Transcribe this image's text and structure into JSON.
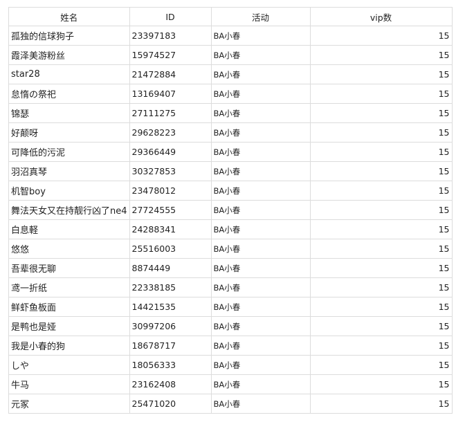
{
  "table": {
    "headers": [
      "姓名",
      "ID",
      "活动",
      "vip数"
    ],
    "rows": [
      {
        "name": "孤独的信球狗子",
        "id": "23397183",
        "activity": "BA小春",
        "vip": "15"
      },
      {
        "name": "霞泽美游粉丝",
        "id": "15974527",
        "activity": "BA小春",
        "vip": "15"
      },
      {
        "name": "star28",
        "id": "21472884",
        "activity": "BA小春",
        "vip": "15"
      },
      {
        "name": "怠惰の祭祀",
        "id": "13169407",
        "activity": "BA小春",
        "vip": "15"
      },
      {
        "name": "锦瑟",
        "id": "27111275",
        "activity": "BA小春",
        "vip": "15"
      },
      {
        "name": "好颠呀",
        "id": "29628223",
        "activity": "BA小春",
        "vip": "15"
      },
      {
        "name": "可降低的污泥",
        "id": "29366449",
        "activity": "BA小春",
        "vip": "15"
      },
      {
        "name": "羽沼真琴",
        "id": "30327853",
        "activity": "BA小春",
        "vip": "15"
      },
      {
        "name": "机智boy",
        "id": "23478012",
        "activity": "BA小春",
        "vip": "15"
      },
      {
        "name": "舞法天女又在持靓行凶了ne4",
        "id": "27724555",
        "activity": "BA小春",
        "vip": "15"
      },
      {
        "name": "白息軽",
        "id": "24288341",
        "activity": "BA小春",
        "vip": "15"
      },
      {
        "name": "悠悠",
        "id": "25516003",
        "activity": "BA小春",
        "vip": "15"
      },
      {
        "name": "吾辈很无聊",
        "id": "8874449",
        "activity": "BA小春",
        "vip": "15"
      },
      {
        "name": "鸢一折纸",
        "id": "22338185",
        "activity": "BA小春",
        "vip": "15"
      },
      {
        "name": "鲜虾鱼板面",
        "id": "14421535",
        "activity": "BA小春",
        "vip": "15"
      },
      {
        "name": "是鸭也是娅",
        "id": "30997206",
        "activity": "BA小春",
        "vip": "15"
      },
      {
        "name": "我是小春的狗",
        "id": "18678717",
        "activity": "BA小春",
        "vip": "15"
      },
      {
        "name": "しや",
        "id": "18056333",
        "activity": "BA小春",
        "vip": "15"
      },
      {
        "name": "牛马",
        "id": "23162408",
        "activity": "BA小春",
        "vip": "15"
      },
      {
        "name": "元冢",
        "id": "25471020",
        "activity": "BA小春",
        "vip": "15"
      }
    ]
  }
}
